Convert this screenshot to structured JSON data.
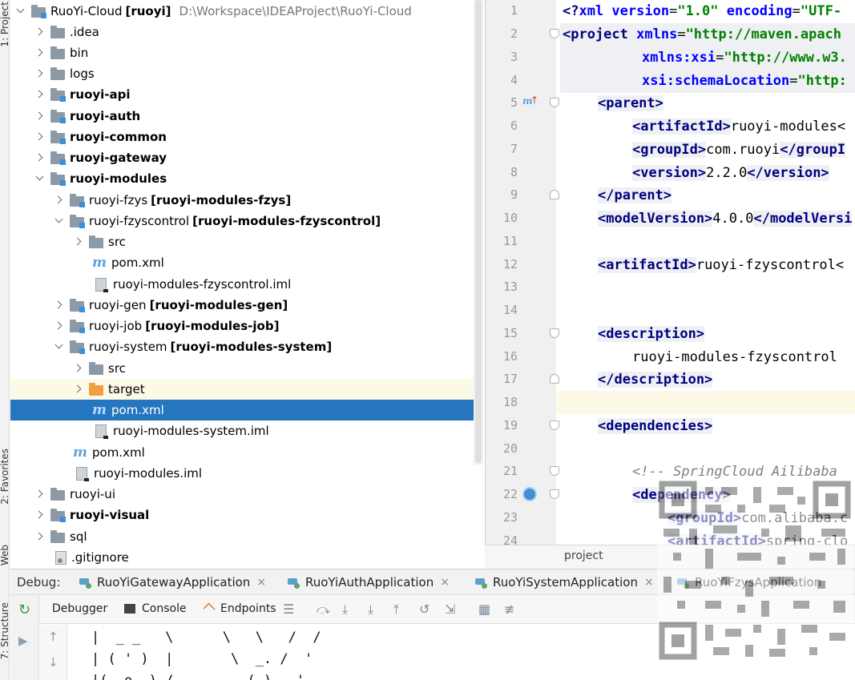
{
  "tool_windows": {
    "project": "1: Project",
    "favorites": "2: Favorites",
    "web": "Web",
    "structure": "7: Structure"
  },
  "tree": {
    "root_name": "RuoYi-Cloud",
    "root_module": "[ruoyi]",
    "root_path": "D:\\Workspace\\IDEAProject\\RuoYi-Cloud",
    "items": [
      {
        "label": "RuoYi-Cloud"
      },
      {
        "label": ".idea"
      },
      {
        "label": "bin"
      },
      {
        "label": "logs"
      },
      {
        "label": "ruoyi-api"
      },
      {
        "label": "ruoyi-auth"
      },
      {
        "label": "ruoyi-common"
      },
      {
        "label": "ruoyi-gateway"
      },
      {
        "label": "ruoyi-modules"
      },
      {
        "label": "ruoyi-fzys",
        "module": "[ruoyi-modules-fzys]"
      },
      {
        "label": "ruoyi-fzyscontrol",
        "module": "[ruoyi-modules-fzyscontrol]"
      },
      {
        "label": "src"
      },
      {
        "label": "pom.xml"
      },
      {
        "label": "ruoyi-modules-fzyscontrol.iml"
      },
      {
        "label": "ruoyi-gen",
        "module": "[ruoyi-modules-gen]"
      },
      {
        "label": "ruoyi-job",
        "module": "[ruoyi-modules-job]"
      },
      {
        "label": "ruoyi-system",
        "module": "[ruoyi-modules-system]"
      },
      {
        "label": "src"
      },
      {
        "label": "target"
      },
      {
        "label": "pom.xml"
      },
      {
        "label": "ruoyi-modules-system.iml"
      },
      {
        "label": "pom.xml"
      },
      {
        "label": "ruoyi-modules.iml"
      },
      {
        "label": "ruoyi-ui"
      },
      {
        "label": "ruoyi-visual"
      },
      {
        "label": "sql"
      },
      {
        "label": ".gitignore"
      }
    ]
  },
  "editor": {
    "line_numbers": [
      "1",
      "2",
      "3",
      "4",
      "5",
      "6",
      "7",
      "8",
      "9",
      "10",
      "11",
      "12",
      "13",
      "14",
      "15",
      "16",
      "17",
      "18",
      "19",
      "20",
      "21",
      "22",
      "23",
      "24"
    ],
    "breadcrumb": "project",
    "gutter_maven_marker": "m",
    "lines": {
      "l1_a": "<?",
      "l1_b": "xml version",
      "l1_c": "=",
      "l1_d": "\"1.0\"",
      "l1_e": " encoding",
      "l1_f": "=",
      "l1_g": "\"UTF-",
      "l2_tag": "<project ",
      "l2_attr": "xmlns",
      "l2_eq": "=",
      "l2_val": "\"http://maven.apach",
      "l3_attr": "xmlns:xsi",
      "l3_eq": "=",
      "l3_val": "\"http://www.w3.",
      "l4_attr": "xsi:schemaLocation",
      "l4_eq": "=",
      "l4_val": "\"http:",
      "l5": "<parent>",
      "l6_open": "<artifactId>",
      "l6_text": "ruoyi-modules<",
      "l7_open": "<groupId>",
      "l7_text": "com.ruoyi",
      "l7_close": "</groupI",
      "l8_open": "<version>",
      "l8_text": "2.2.0",
      "l8_close": "</version>",
      "l9": "</parent>",
      "l10_open": "<modelVersion>",
      "l10_text": "4.0.0",
      "l10_close": "</modelVersi",
      "l12_open": "<artifactId>",
      "l12_text": "ruoyi-fzyscontrol<",
      "l15": "<description>",
      "l16": "ruoyi-modules-fzyscontrol",
      "l17": "</description>",
      "l19": "<dependencies>",
      "l21": "<!-- SpringCloud Ailibaba",
      "l22": "<dependency>",
      "l23_open": "<groupId>",
      "l23_text": "com.alibaba.c",
      "l24_open": "<artifactId>",
      "l24_text": "spring-clo"
    }
  },
  "debug": {
    "label": "Debug:",
    "sessions": [
      {
        "name": "RuoYiGatewayApplication"
      },
      {
        "name": "RuoYiAuthApplication"
      },
      {
        "name": "RuoYiSystemApplication"
      },
      {
        "name": "RuoYiFzysApplication"
      }
    ],
    "close_glyph": "×",
    "tabs": {
      "debugger": "Debugger",
      "console": "Console",
      "endpoints": "Endpoints"
    }
  },
  "console": {
    "lines": [
      "|  _ _   \\      \\   \\   /  /",
      "| ( ' )  |       \\  _. /  '",
      "|(_ o _) /        _( )_ .'"
    ]
  },
  "colors": {
    "selection": "#2675bf",
    "current_line": "#fcfae6",
    "tag": "#000080",
    "attribute_value": "#008000",
    "comment": "#808080"
  }
}
